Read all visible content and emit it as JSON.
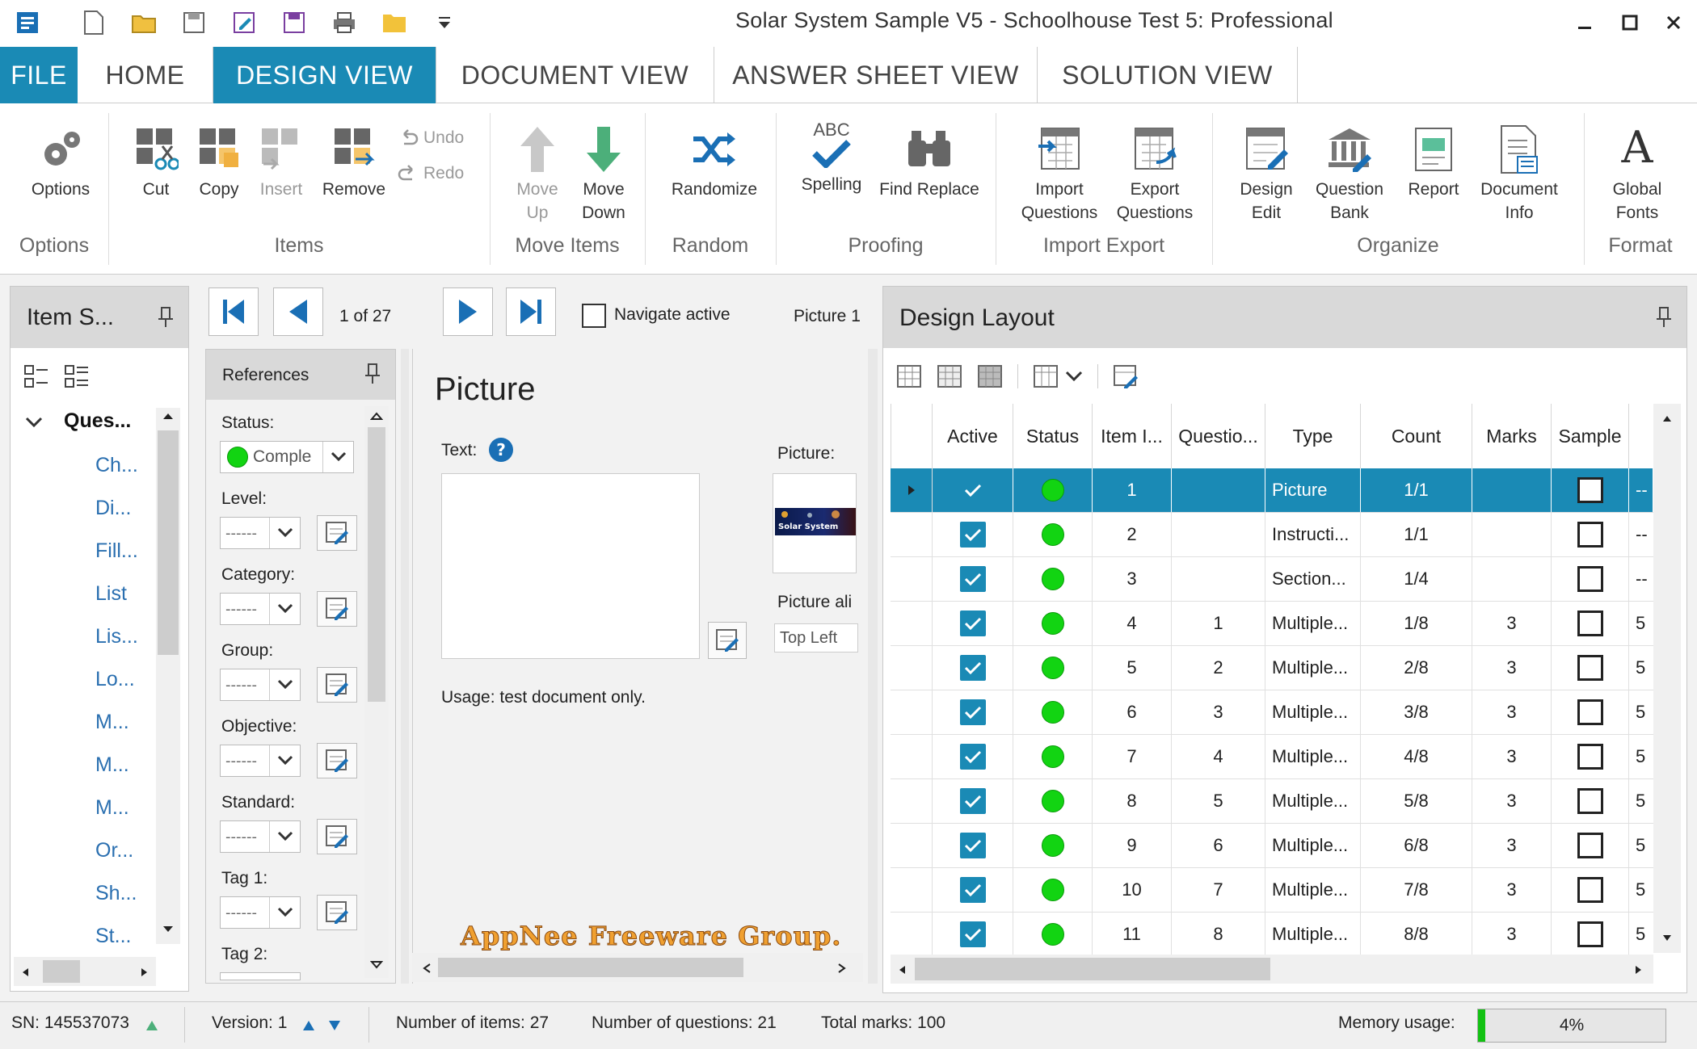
{
  "window": {
    "title": "Solar System Sample V5 - Schoolhouse Test 5: Professional"
  },
  "tabs": [
    "FILE",
    "HOME",
    "DESIGN VIEW",
    "DOCUMENT VIEW",
    "ANSWER SHEET VIEW",
    "SOLUTION VIEW"
  ],
  "ribbon": {
    "options": "Options",
    "cut": "Cut",
    "copy": "Copy",
    "insert": "Insert",
    "remove": "Remove",
    "undo": "Undo",
    "redo": "Redo",
    "move_up_1": "Move",
    "move_up_2": "Up",
    "move_down_1": "Move",
    "move_down_2": "Down",
    "randomize": "Randomize",
    "spelling": "Spelling",
    "spelling_abc": "ABC",
    "find_replace": "Find Replace",
    "import_1": "Import",
    "import_2": "Questions",
    "export_1": "Export",
    "export_2": "Questions",
    "design_1": "Design",
    "design_2": "Edit",
    "qbank_1": "Question",
    "qbank_2": "Bank",
    "report": "Report",
    "docinfo_1": "Document",
    "docinfo_2": "Info",
    "fonts_1": "Global",
    "fonts_2": "Fonts",
    "fonts_glyph": "A",
    "groups": {
      "options": "Options",
      "items": "Items",
      "move": "Move Items",
      "random": "Random",
      "proofing": "Proofing",
      "import_export": "Import Export",
      "organize": "Organize",
      "format": "Format"
    }
  },
  "item_panel": {
    "title": "Item S...",
    "root": "Ques...",
    "children": [
      "Ch...",
      "Di...",
      "Fill...",
      "List",
      "Lis...",
      "Lo...",
      "M...",
      "M...",
      "M...",
      "Or...",
      "Sh...",
      "St..."
    ]
  },
  "nav": {
    "counter": "1 of 27",
    "navigate_active": "Navigate active",
    "current": "Picture 1"
  },
  "references": {
    "title": "References",
    "status_label": "Status:",
    "status_value": "Comple",
    "placeholder": "------",
    "fields": [
      "Level:",
      "Category:",
      "Group:",
      "Objective:",
      "Standard:",
      "Tag 1:",
      "Tag 2:"
    ]
  },
  "editor": {
    "heading": "Picture",
    "text_label": "Text:",
    "help": "?",
    "usage": "Usage: test document only.",
    "picture_label": "Picture:",
    "picture_caption": "Solar System",
    "align_label": "Picture ali",
    "align_value": "Top Left",
    "watermark": "AppNee Freeware Group."
  },
  "layout": {
    "title": "Design Layout",
    "columns": [
      "Active",
      "Status",
      "Item I...",
      "Questio...",
      "Type",
      "Count",
      "Marks",
      "Sample"
    ],
    "rows": [
      {
        "item": "1",
        "q": "",
        "type": "Picture",
        "count": "1/1",
        "marks": "",
        "extra": "--"
      },
      {
        "item": "2",
        "q": "",
        "type": "Instructi...",
        "count": "1/1",
        "marks": "",
        "extra": "--"
      },
      {
        "item": "3",
        "q": "",
        "type": "Section...",
        "count": "1/4",
        "marks": "",
        "extra": "--"
      },
      {
        "item": "4",
        "q": "1",
        "type": "Multiple...",
        "count": "1/8",
        "marks": "3",
        "extra": "5"
      },
      {
        "item": "5",
        "q": "2",
        "type": "Multiple...",
        "count": "2/8",
        "marks": "3",
        "extra": "5"
      },
      {
        "item": "6",
        "q": "3",
        "type": "Multiple...",
        "count": "3/8",
        "marks": "3",
        "extra": "5"
      },
      {
        "item": "7",
        "q": "4",
        "type": "Multiple...",
        "count": "4/8",
        "marks": "3",
        "extra": "5"
      },
      {
        "item": "8",
        "q": "5",
        "type": "Multiple...",
        "count": "5/8",
        "marks": "3",
        "extra": "5"
      },
      {
        "item": "9",
        "q": "6",
        "type": "Multiple...",
        "count": "6/8",
        "marks": "3",
        "extra": "5"
      },
      {
        "item": "10",
        "q": "7",
        "type": "Multiple...",
        "count": "7/8",
        "marks": "3",
        "extra": "5"
      },
      {
        "item": "11",
        "q": "8",
        "type": "Multiple...",
        "count": "8/8",
        "marks": "3",
        "extra": "5"
      }
    ]
  },
  "statusbar": {
    "sn": "SN: 145537073",
    "version": "Version: 1",
    "items": "Number of items: 27",
    "questions": "Number of questions: 21",
    "marks": "Total marks: 100",
    "memory_label": "Memory usage:",
    "memory_value": "4%",
    "memory_fraction": 0.04
  },
  "colors": {
    "accent": "#1a8ab5",
    "status_green": "#12d412"
  }
}
